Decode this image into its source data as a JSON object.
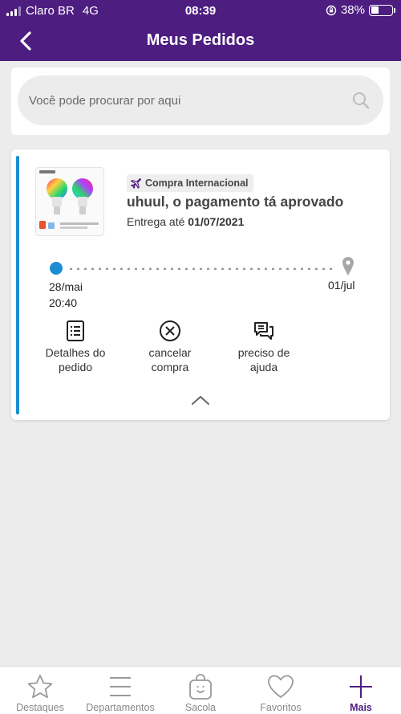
{
  "status_bar": {
    "carrier": "Claro BR",
    "network": "4G",
    "time": "08:39",
    "battery": "38%",
    "battery_level": 0.38
  },
  "header": {
    "title": "Meus Pedidos",
    "back_icon": "chevron-left-icon",
    "color": "#4e1d80"
  },
  "search": {
    "placeholder": "Você pode procurar por aqui",
    "icon": "search-icon"
  },
  "order": {
    "badge": "Compra Internacional",
    "badge_icon": "airplane-icon",
    "status": "uhuul, o pagamento tá aprovado",
    "delivery_prefix": "Entrega até",
    "delivery_date": "01/07/2021",
    "accent_color": "#1a8ed1",
    "timeline": {
      "start_date": "28/mai",
      "start_time": "20:40",
      "end_date": "01/jul"
    },
    "actions": [
      {
        "label_line1": "Detalhes do",
        "label_line2": "pedido",
        "icon": "list-icon"
      },
      {
        "label_line1": "cancelar",
        "label_line2": "compra",
        "icon": "cancel-circle-icon"
      },
      {
        "label_line1": "preciso de",
        "label_line2": "ajuda",
        "icon": "chat-icon"
      }
    ]
  },
  "tabs": [
    {
      "label": "Destaques",
      "icon": "star-icon"
    },
    {
      "label": "Departamentos",
      "icon": "menu-icon"
    },
    {
      "label": "Sacola",
      "icon": "bag-icon"
    },
    {
      "label": "Favoritos",
      "icon": "heart-icon"
    },
    {
      "label": "Mais",
      "icon": "plus-icon",
      "active": true
    }
  ]
}
